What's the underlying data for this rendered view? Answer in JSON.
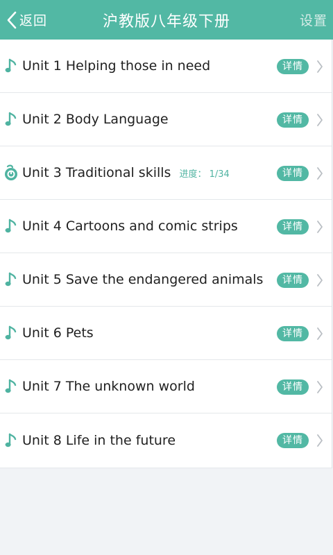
{
  "header": {
    "back_label": "返回",
    "title": "沪教版八年级下册",
    "settings_label": "设置"
  },
  "colors": {
    "accent": "#52b8a4",
    "background": "#f1f3f6"
  },
  "units": [
    {
      "label": "Unit 1 Helping those in need",
      "icon": "music-note-icon",
      "progress": "",
      "detail": "详情"
    },
    {
      "label": "Unit 2 Body Language",
      "icon": "music-note-icon",
      "progress": "",
      "detail": "详情"
    },
    {
      "label": "Unit 3 Traditional skills",
      "icon": "loop-playing-icon",
      "progress": "进度： 1/34",
      "detail": "详情"
    },
    {
      "label": "Unit 4 Cartoons and comic strips",
      "icon": "music-note-icon",
      "progress": "",
      "detail": "详情"
    },
    {
      "label": "Unit 5 Save the endangered animals",
      "icon": "music-note-icon",
      "progress": "",
      "detail": "详情"
    },
    {
      "label": "Unit 6 Pets",
      "icon": "music-note-icon",
      "progress": "",
      "detail": "详情"
    },
    {
      "label": "Unit 7 The unknown world",
      "icon": "music-note-icon",
      "progress": "",
      "detail": "详情"
    },
    {
      "label": "Unit 8 Life in the future",
      "icon": "music-note-icon",
      "progress": "",
      "detail": "详情"
    }
  ]
}
